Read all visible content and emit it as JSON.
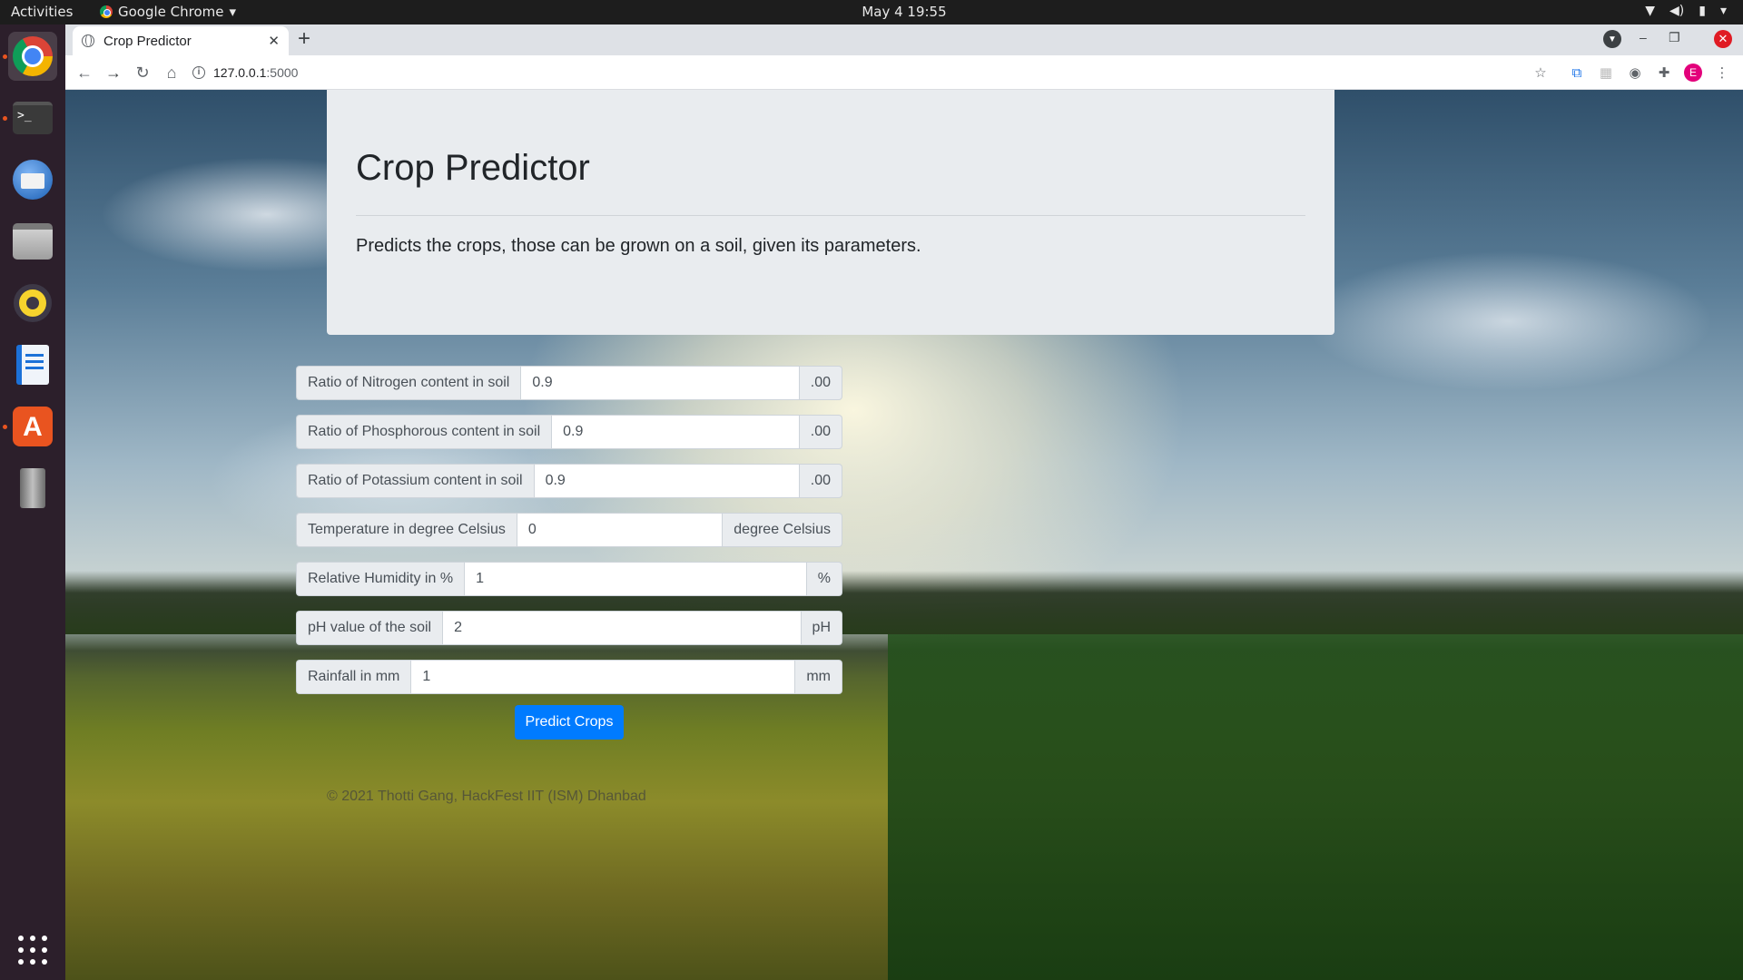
{
  "topbar": {
    "activities": "Activities",
    "app_name": "Google Chrome",
    "clock": "May 4  19:55"
  },
  "browser": {
    "tab_title": "Crop Predictor",
    "url_host": "127.0.0.1",
    "url_port": ":5000",
    "profile_initial": "E"
  },
  "page": {
    "title": "Crop Predictor",
    "lead": "Predicts the crops, those can be grown on a soil, given its parameters.",
    "fields": [
      {
        "label": "Ratio of Nitrogen content in soil",
        "value": "0.9",
        "suffix": ".00"
      },
      {
        "label": "Ratio of Phosphorous content in soil",
        "value": "0.9",
        "suffix": ".00"
      },
      {
        "label": "Ratio of Potassium content in soil",
        "value": "0.9",
        "suffix": ".00"
      },
      {
        "label": "Temperature in degree Celsius",
        "value": "0",
        "suffix": "degree Celsius"
      },
      {
        "label": "Relative Humidity in %",
        "value": "1",
        "suffix": "%"
      },
      {
        "label": "pH value of the soil",
        "value": "2",
        "suffix": "pH"
      },
      {
        "label": "Rainfall in mm",
        "value": "1",
        "suffix": "mm"
      }
    ],
    "submit_label": "Predict Crops",
    "footer": "© 2021 Thotti Gang, HackFest IIT (ISM) Dhanbad"
  }
}
